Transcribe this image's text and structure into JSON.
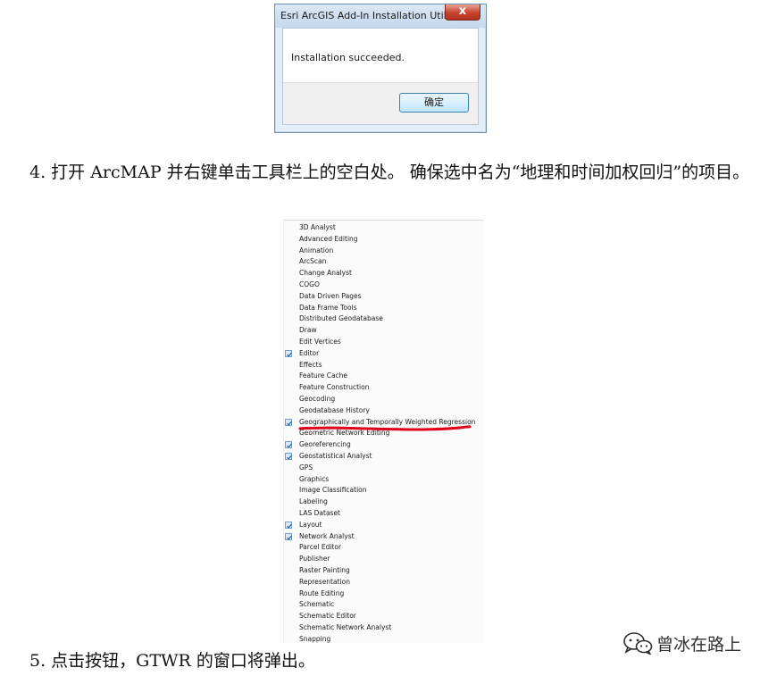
{
  "dialog": {
    "title": "Esri ArcGIS Add-In Installation Util...",
    "close_symbol": "x",
    "message": "Installation succeeded.",
    "ok_label": "确定"
  },
  "document": {
    "step4": "4. 打开 ArcMAP 并右键单击工具栏上的空白处。 确保选中名为“地理和时间加权回归”的项目。",
    "step5": "5. 点击按钮，GTWR 的窗口将弹出。"
  },
  "toolbar_menu": {
    "items": [
      {
        "label": "3D Analyst",
        "checked": false
      },
      {
        "label": "Advanced Editing",
        "checked": false
      },
      {
        "label": "Animation",
        "checked": false
      },
      {
        "label": "ArcScan",
        "checked": false
      },
      {
        "label": "Change Analyst",
        "checked": false
      },
      {
        "label": "COGO",
        "checked": false
      },
      {
        "label": "Data Driven Pages",
        "checked": false
      },
      {
        "label": "Data Frame Tools",
        "checked": false
      },
      {
        "label": "Distributed Geodatabase",
        "checked": false
      },
      {
        "label": "Draw",
        "checked": false
      },
      {
        "label": "Edit Vertices",
        "checked": false
      },
      {
        "label": "Editor",
        "checked": true
      },
      {
        "label": "Effects",
        "checked": false
      },
      {
        "label": "Feature Cache",
        "checked": false
      },
      {
        "label": "Feature Construction",
        "checked": false
      },
      {
        "label": "Geocoding",
        "checked": false
      },
      {
        "label": "Geodatabase History",
        "checked": false
      },
      {
        "label": "Geographically and Temporally Weighted Regression",
        "checked": true
      },
      {
        "label": "Geometric Network Editing",
        "checked": false
      },
      {
        "label": "Georeferencing",
        "checked": true
      },
      {
        "label": "Geostatistical Analyst",
        "checked": true
      },
      {
        "label": "GPS",
        "checked": false
      },
      {
        "label": "Graphics",
        "checked": false
      },
      {
        "label": "Image Classification",
        "checked": false
      },
      {
        "label": "Labeling",
        "checked": false
      },
      {
        "label": "LAS Dataset",
        "checked": false
      },
      {
        "label": "Layout",
        "checked": true
      },
      {
        "label": "Network Analyst",
        "checked": true
      },
      {
        "label": "Parcel Editor",
        "checked": false
      },
      {
        "label": "Publisher",
        "checked": false
      },
      {
        "label": "Raster Painting",
        "checked": false
      },
      {
        "label": "Representation",
        "checked": false
      },
      {
        "label": "Route Editing",
        "checked": false
      },
      {
        "label": "Schematic",
        "checked": false
      },
      {
        "label": "Schematic Editor",
        "checked": false
      },
      {
        "label": "Schematic Network Analyst",
        "checked": false
      },
      {
        "label": "Snapping",
        "checked": false
      }
    ],
    "check_color": "#2b5fa6",
    "highlight_stroke_color": "#e0001b"
  },
  "watermark": {
    "icon": "wechat-icon",
    "text": "曾冰在路上"
  }
}
